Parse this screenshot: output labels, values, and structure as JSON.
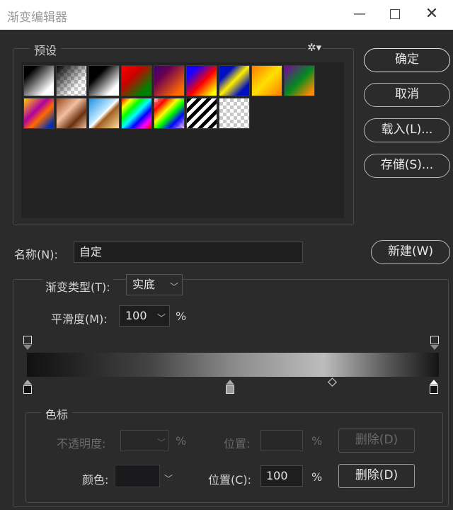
{
  "window": {
    "title": "渐变编辑器",
    "minimize": "—",
    "close": "✕"
  },
  "presets": {
    "label": "预设",
    "swatches": [
      {
        "name": "foreground-to-background",
        "gradient": "linear-gradient(135deg,#000 0%,#000 20%,#fff 80%)"
      },
      {
        "name": "foreground-to-transparent",
        "gradient": "linear-gradient(135deg,#000 0%,rgba(0,0,0,0) 70%)"
      },
      {
        "name": "black-white",
        "gradient": "linear-gradient(135deg,#000 0%,#000 30%,#fff 80%)"
      },
      {
        "name": "red-green",
        "gradient": "linear-gradient(135deg,#ff0000 0%,#cc0000 35%,#008000 80%)"
      },
      {
        "name": "violet-orange",
        "gradient": "linear-gradient(135deg,#3a007a 0%,#6a0050 30%,#ff6a00 85%)"
      },
      {
        "name": "blue-red-yellow",
        "gradient": "linear-gradient(135deg,#1a00ff 0%,#1a00ff 20%,#ff0000 55%,#ffff00 90%)"
      },
      {
        "name": "blue-yellow-blue",
        "gradient": "linear-gradient(135deg,#0010c0 0%,#0010c0 25%,#ffef00 50%,#0010c0 80%)"
      },
      {
        "name": "orange-yellow-orange",
        "gradient": "linear-gradient(135deg,#ff7a00 0%,#ffe000 50%,#ff7a00 100%)"
      },
      {
        "name": "violet-green-orange",
        "gradient": "linear-gradient(135deg,#8000a0 0%,#008a20 50%,#ff8a00 90%)"
      },
      {
        "name": "yellow-violet-orange-blue",
        "gradient": "linear-gradient(135deg,#ffd000 0%,#b000a0 40%,#ff6a00 60%,#0030b0 90%)"
      },
      {
        "name": "copper",
        "gradient": "linear-gradient(135deg,#9a4a20 0%,#f0c0a0 40%,#6a3010 70%,#f0c0a0 100%)"
      },
      {
        "name": "chrome",
        "gradient": "linear-gradient(135deg,#2090e0 0%,#c0e8ff 45%,#ffffff 50%,#a06020 60%,#ffe0a0 100%)"
      },
      {
        "name": "spectrum",
        "gradient": "linear-gradient(135deg,#ff0000,#ffff00,#00ff00,#00ffff,#0000ff,#ff00ff,#ff0000)"
      },
      {
        "name": "transparent-rainbow",
        "gradient": "linear-gradient(135deg,rgba(255,0,0,0.2) 0%,#ff0000 20%,#ffff00 40%,#00ff00 55%,#0000ff 75%,rgba(255,0,255,0.2) 100%)"
      },
      {
        "name": "transparent-stripes",
        "gradient": "repeating-linear-gradient(135deg,#000 0 5px,#fff 5px 10px)"
      },
      {
        "name": "transparent",
        "gradient": "none"
      }
    ]
  },
  "buttons": {
    "ok": "确定",
    "cancel": "取消",
    "load": "载入(L)...",
    "save": "存储(S)...",
    "new": "新建(W)"
  },
  "name": {
    "label": "名称(N):",
    "value": "自定"
  },
  "gradient": {
    "type_label": "渐变类型(T):",
    "type_value": "实底",
    "smoothness_label": "平滑度(M):",
    "smoothness_value": "100",
    "percent": "%"
  },
  "stops": {
    "label": "色标",
    "opacity_label": "不透明度:",
    "opacity_value": "",
    "opacity_unit": "%",
    "opacity_location_label": "位置:",
    "opacity_location_value": "",
    "opacity_location_unit": "%",
    "opacity_delete": "删除(D)",
    "color_label": "颜色:",
    "color_value": "#1a1a1c",
    "color_location_label": "位置(C):",
    "color_location_value": "100",
    "color_location_unit": "%",
    "color_delete": "删除(D)"
  }
}
